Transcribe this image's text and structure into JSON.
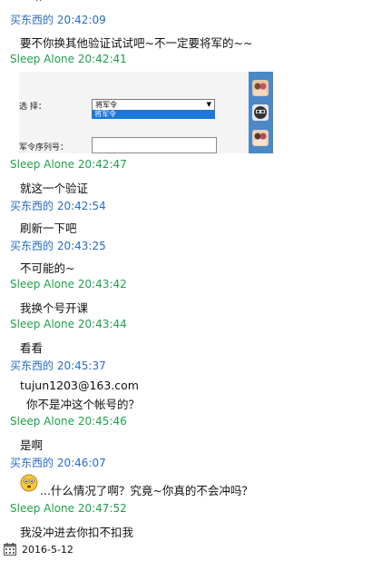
{
  "top_fragment": "··",
  "messages": [
    {
      "sender": "买东西的",
      "time": "20:42:09",
      "lines": [
        "要不你换其他验证试试吧~不一定要将军的~~"
      ]
    },
    {
      "sender": "Sleep Alone",
      "time": "20:42:41",
      "lines": []
    },
    {
      "sender": "Sleep Alone",
      "time": "20:42:47",
      "lines": [
        "就这一个验证"
      ]
    },
    {
      "sender": "买东西的",
      "time": "20:42:54",
      "lines": [
        "刷新一下吧"
      ]
    },
    {
      "sender": "买东西的",
      "time": "20:43:25",
      "lines": [
        "不可能的~"
      ]
    },
    {
      "sender": "Sleep Alone",
      "time": "20:43:42",
      "lines": [
        "我换个号开课"
      ]
    },
    {
      "sender": "Sleep Alone",
      "time": "20:43:44",
      "lines": [
        "看看"
      ]
    },
    {
      "sender": "买东西的",
      "time": "20:45:37",
      "lines": [
        "tujun1203@163.com",
        "你不是冲这个帐号的？"
      ]
    },
    {
      "sender": "Sleep Alone",
      "time": "20:45:46",
      "lines": [
        "是啊"
      ]
    },
    {
      "sender": "买东西的",
      "time": "20:46:07",
      "lines": [
        "...什么情况了啊？究竟~你真的不会冲吗？"
      ]
    },
    {
      "sender": "Sleep Alone",
      "time": "20:47:52",
      "lines": [
        "我没冲进去你扣不扣我"
      ]
    }
  ],
  "embedded_screenshot": {
    "select_label": "选 择：",
    "select_value": "将军令",
    "option_value": "将军令",
    "serial_label": "军令序列号："
  },
  "emoji_icon": "confused-face-icon",
  "status_bar": {
    "date": "2016-5-12",
    "icon": "calendar-icon"
  },
  "colors": {
    "buyer": "#2a6bc7",
    "sleep_alone": "#1fa04a",
    "selection": "#1b78d9",
    "side_panel": "#4c87c8"
  }
}
